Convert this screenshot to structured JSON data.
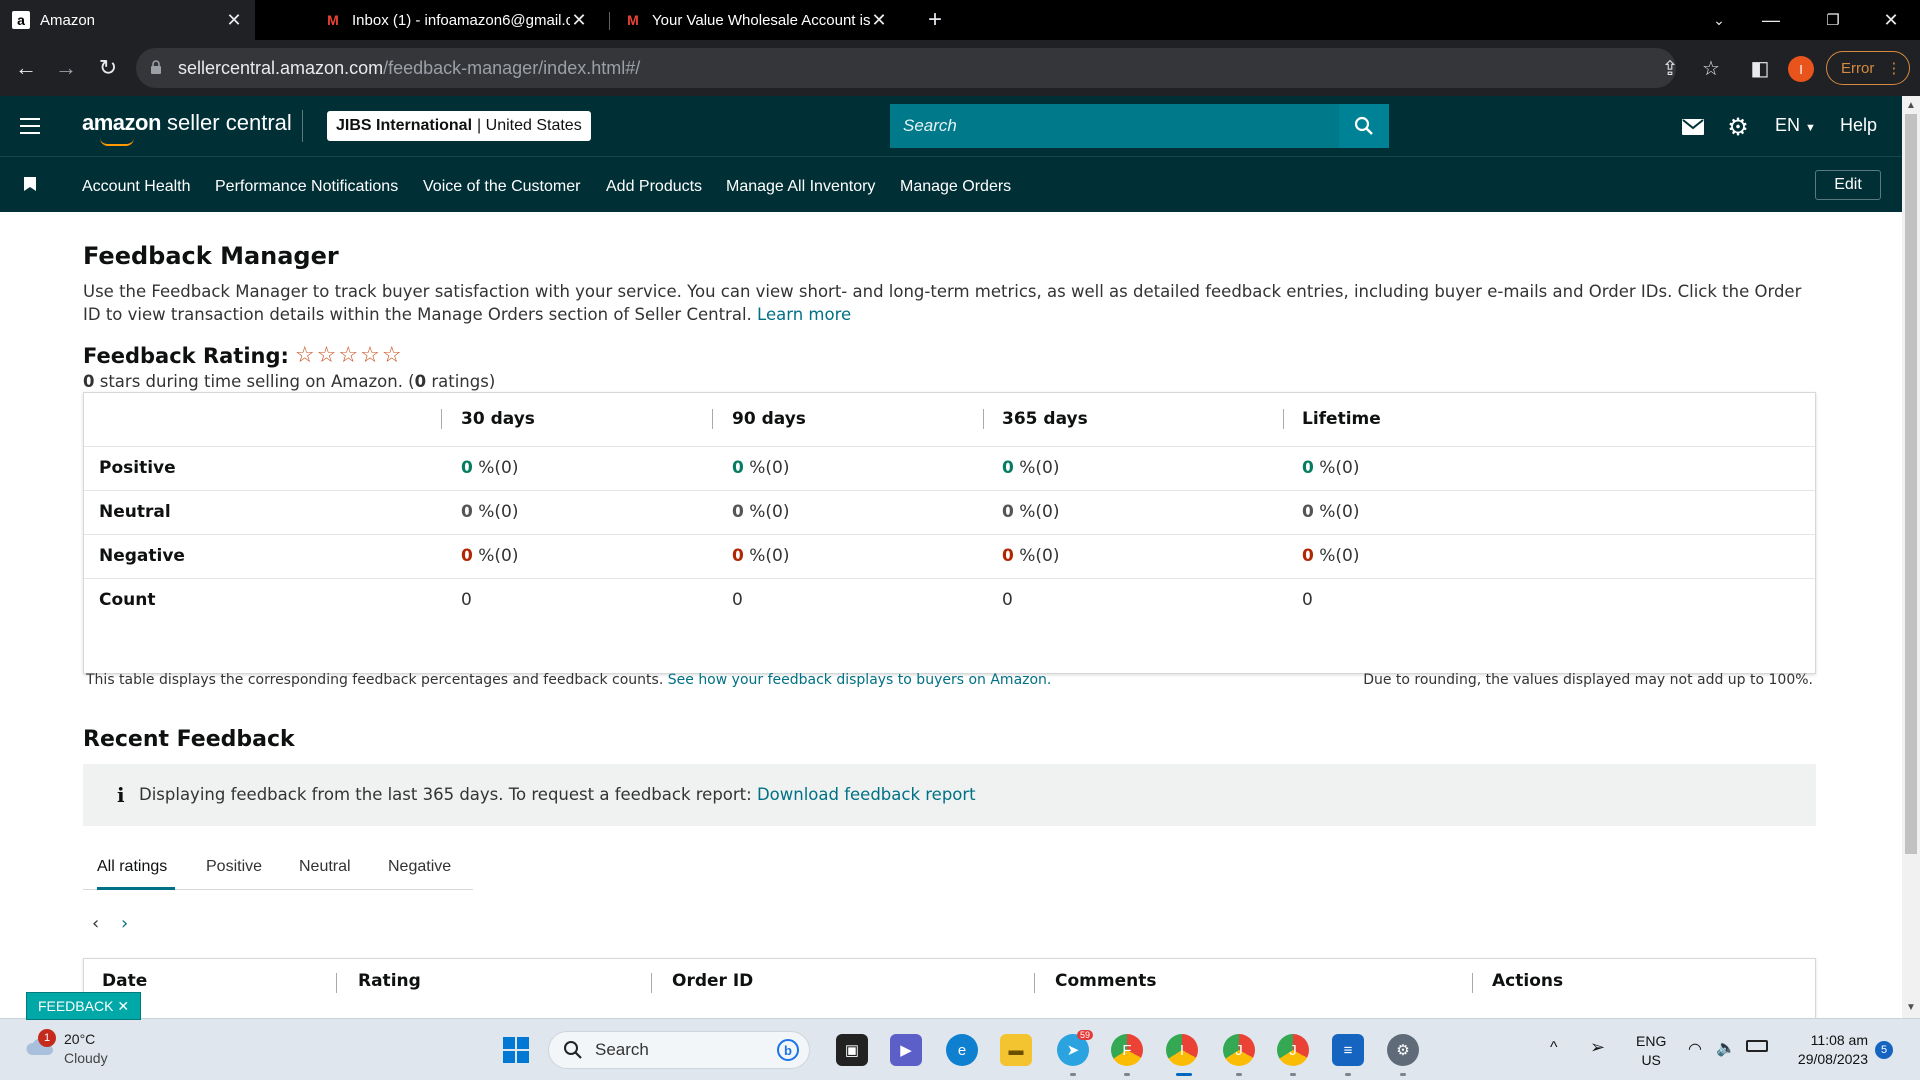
{
  "browser": {
    "tabs": [
      {
        "title": "Amazon",
        "favicon": "a",
        "active": true
      },
      {
        "title": "Inbox (1) - infoamazon6@gmail.c",
        "favicon": "M",
        "active": false
      },
      {
        "title": "Your Value Wholesale Account is",
        "favicon": "M",
        "active": false
      }
    ],
    "url_host": "sellercentral.amazon.com",
    "url_path": "/feedback-manager/index.html#/",
    "profile_initial": "I",
    "error_label": "Error"
  },
  "header": {
    "logo_brand": "amazon",
    "logo_product": "seller central",
    "store_name": "JIBS International",
    "store_region": "United States",
    "search_placeholder": "Search",
    "language": "EN",
    "help_label": "Help"
  },
  "nav": {
    "links": [
      "Account Health",
      "Performance Notifications",
      "Voice of the Customer",
      "Add Products",
      "Manage All Inventory",
      "Manage Orders"
    ],
    "edit_label": "Edit"
  },
  "page": {
    "title": "Feedback Manager",
    "description": "Use the Feedback Manager to track buyer satisfaction with your service. You can view short- and long-term metrics, as well as detailed feedback entries, including buyer e-mails and Order IDs. Click the Order ID to view transaction details within the Manage Orders section of Seller Central.",
    "learn_more": "Learn more",
    "rating_title": "Feedback Rating:",
    "rating_stars": 0,
    "rating_count": 0,
    "rating_sub_prefix": " stars during time selling on Amazon. (",
    "rating_sub_suffix": " ratings)"
  },
  "feedback_table": {
    "columns": [
      "30 days",
      "90 days",
      "365 days",
      "Lifetime"
    ],
    "rows": [
      {
        "label": "Positive",
        "kind": "pos",
        "values": [
          "0",
          "0",
          "0",
          "0"
        ],
        "counts": [
          "%(0)",
          "%(0)",
          "%(0)",
          "%(0)"
        ]
      },
      {
        "label": "Neutral",
        "kind": "neu",
        "values": [
          "0",
          "0",
          "0",
          "0"
        ],
        "counts": [
          "%(0)",
          "%(0)",
          "%(0)",
          "%(0)"
        ]
      },
      {
        "label": "Negative",
        "kind": "neg",
        "values": [
          "0",
          "0",
          "0",
          "0"
        ],
        "counts": [
          "%(0)",
          "%(0)",
          "%(0)",
          "%(0)"
        ]
      }
    ],
    "count_row": {
      "label": "Count",
      "values": [
        "0",
        "0",
        "0",
        "0"
      ]
    },
    "note": "This table displays the corresponding feedback percentages and feedback counts.",
    "note_link": "See how your feedback displays to buyers on Amazon.",
    "rounding_note": "Due to rounding, the values displayed may not add up to 100%."
  },
  "recent": {
    "title": "Recent Feedback",
    "info_text": "Displaying feedback from the last 365 days. To request a feedback report:",
    "info_link": "Download feedback report",
    "tabs": [
      "All ratings",
      "Positive",
      "Neutral",
      "Negative"
    ],
    "selected_tab": "All ratings",
    "columns": [
      "Date",
      "Rating",
      "Order ID",
      "Comments",
      "Actions"
    ]
  },
  "feedback_tag": "FEEDBACK",
  "taskbar": {
    "temperature": "20°C",
    "condition": "Cloudy",
    "weather_badge": "1",
    "search_label": "Search",
    "language": "ENG",
    "region": "US",
    "time": "11:08 am",
    "date": "29/08/2023",
    "notification_count": "5",
    "telegram_badge": "59"
  },
  "colors": {
    "header_bg": "#002f36",
    "search_bg": "#00798b",
    "link": "#007185",
    "positive": "#067d62",
    "negative": "#b12704",
    "star": "#c7511f"
  }
}
